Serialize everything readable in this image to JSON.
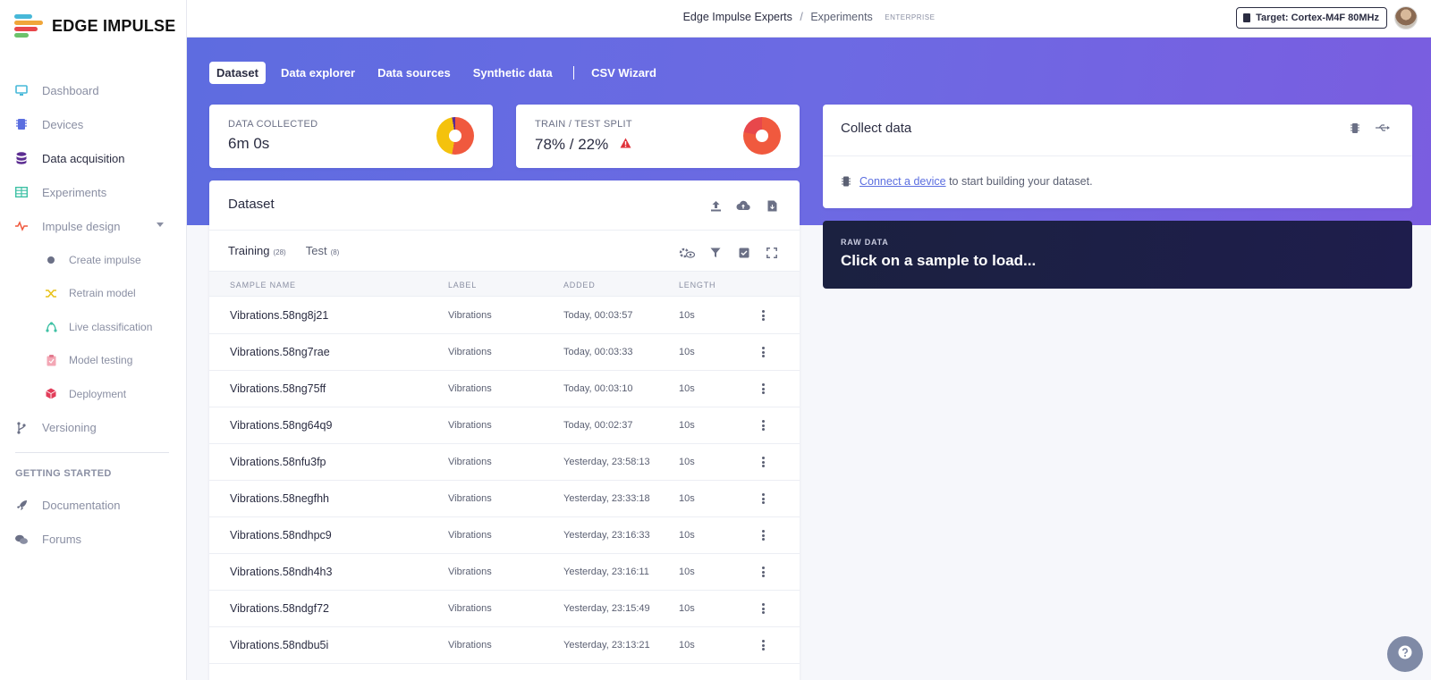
{
  "brand": {
    "name": "EDGE IMPULSE"
  },
  "sidebar": {
    "items": [
      {
        "label": "Dashboard",
        "icon": "monitor-icon"
      },
      {
        "label": "Devices",
        "icon": "chip-icon"
      },
      {
        "label": "Data acquisition",
        "icon": "database-icon",
        "active": true
      },
      {
        "label": "Experiments",
        "icon": "table-icon"
      },
      {
        "label": "Impulse design",
        "icon": "pulse-icon",
        "expandable": true
      }
    ],
    "sub_items": [
      {
        "label": "Create impulse",
        "icon": "dot-icon"
      },
      {
        "label": "Retrain model",
        "icon": "shuffle-icon"
      },
      {
        "label": "Live classification",
        "icon": "network-icon"
      },
      {
        "label": "Model testing",
        "icon": "clipboard-icon"
      },
      {
        "label": "Deployment",
        "icon": "cube-icon"
      }
    ],
    "versioning": {
      "label": "Versioning",
      "icon": "branch-icon"
    },
    "getting_started_heading": "GETTING STARTED",
    "getting_started": [
      {
        "label": "Documentation",
        "icon": "rocket-icon"
      },
      {
        "label": "Forums",
        "icon": "chat-icon"
      }
    ]
  },
  "topbar": {
    "org": "Edge Impulse Experts",
    "separator": "/",
    "project": "Experiments",
    "badge": "ENTERPRISE",
    "target": "Target: Cortex-M4F 80MHz"
  },
  "tabs": [
    "Dataset",
    "Data explorer",
    "Data sources",
    "Synthetic data",
    "CSV Wizard"
  ],
  "stats": {
    "data_collected": {
      "label": "DATA COLLECTED",
      "value": "6m 0s"
    },
    "split": {
      "label": "TRAIN / TEST SPLIT",
      "value": "78% / 22%"
    }
  },
  "colors": {
    "accent": "#6b69e2",
    "orange": "#f0593e",
    "yellow": "#f4c20d",
    "warning": "#e0323a"
  },
  "dataset": {
    "title": "Dataset",
    "subtabs": [
      {
        "label": "Training",
        "count": "(28)"
      },
      {
        "label": "Test",
        "count": "(8)"
      }
    ],
    "columns": [
      "SAMPLE NAME",
      "LABEL",
      "ADDED",
      "LENGTH"
    ],
    "rows": [
      {
        "name": "Vibrations.58ng8j21",
        "label": "Vibrations",
        "added": "Today, 00:03:57",
        "length": "10s"
      },
      {
        "name": "Vibrations.58ng7rae",
        "label": "Vibrations",
        "added": "Today, 00:03:33",
        "length": "10s"
      },
      {
        "name": "Vibrations.58ng75ff",
        "label": "Vibrations",
        "added": "Today, 00:03:10",
        "length": "10s"
      },
      {
        "name": "Vibrations.58ng64q9",
        "label": "Vibrations",
        "added": "Today, 00:02:37",
        "length": "10s"
      },
      {
        "name": "Vibrations.58nfu3fp",
        "label": "Vibrations",
        "added": "Yesterday, 23:58:13",
        "length": "10s"
      },
      {
        "name": "Vibrations.58negfhh",
        "label": "Vibrations",
        "added": "Yesterday, 23:33:18",
        "length": "10s"
      },
      {
        "name": "Vibrations.58ndhpc9",
        "label": "Vibrations",
        "added": "Yesterday, 23:16:33",
        "length": "10s"
      },
      {
        "name": "Vibrations.58ndh4h3",
        "label": "Vibrations",
        "added": "Yesterday, 23:16:11",
        "length": "10s"
      },
      {
        "name": "Vibrations.58ndgf72",
        "label": "Vibrations",
        "added": "Yesterday, 23:15:49",
        "length": "10s"
      },
      {
        "name": "Vibrations.58ndbu5i",
        "label": "Vibrations",
        "added": "Yesterday, 23:13:21",
        "length": "10s"
      }
    ]
  },
  "collect": {
    "title": "Collect data",
    "link": "Connect a device",
    "text": " to start building your dataset."
  },
  "raw_data": {
    "label": "RAW DATA",
    "message": "Click on a sample to load..."
  }
}
